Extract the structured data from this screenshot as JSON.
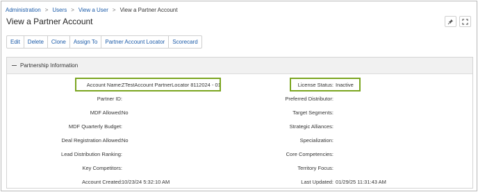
{
  "breadcrumb": {
    "items": [
      "Administration",
      "Users",
      "View a User"
    ],
    "current": "View a Partner Account"
  },
  "page_title": "View a Partner Account",
  "top_icons": [
    "pin-icon",
    "expand-icon"
  ],
  "toolbar": {
    "buttons": [
      "Edit",
      "Delete",
      "Clone",
      "Assign To",
      "Partner Account Locator",
      "Scorecard"
    ]
  },
  "section": {
    "title": "Partnership Information",
    "left": [
      {
        "label": "Account Name:",
        "value": "ZTestAccount PartnerLocator 8112024 - 01"
      },
      {
        "label": "Partner ID:",
        "value": ""
      },
      {
        "label": "MDF Allowed:",
        "value": "No"
      },
      {
        "label": "MDF Quarterly Budget:",
        "value": ""
      },
      {
        "label": "Deal Registration Allowed:",
        "value": "No"
      },
      {
        "label": "Lead Distribution Ranking:",
        "value": ""
      },
      {
        "label": "Key Competitors:",
        "value": ""
      },
      {
        "label": "Account Created:",
        "value": "10/23/24 5:32:10 AM"
      }
    ],
    "right": [
      {
        "label": "License Status:",
        "value": "Inactive"
      },
      {
        "label": "Preferred Distributor:",
        "value": ""
      },
      {
        "label": "Target Segments:",
        "value": ""
      },
      {
        "label": "Strategic Alliances:",
        "value": ""
      },
      {
        "label": "Specialization:",
        "value": ""
      },
      {
        "label": "Core Competencies:",
        "value": ""
      },
      {
        "label": "Territory Focus:",
        "value": ""
      },
      {
        "label": "Last Updated:",
        "value": "01/29/25 11:31:43 AM"
      }
    ]
  },
  "colors": {
    "link": "#1a5aa8",
    "highlight": "#7aa51f"
  }
}
